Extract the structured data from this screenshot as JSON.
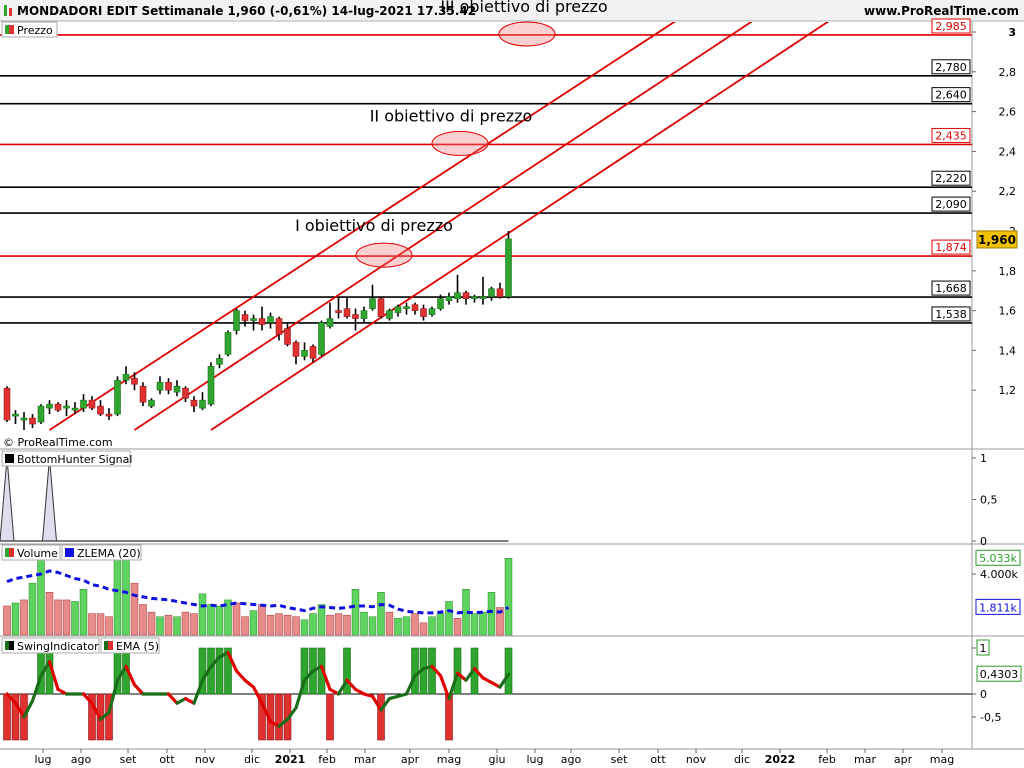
{
  "header": {
    "title": "MONDADORI EDIT Settimanale 1,960 (-0,61%) 14-lug-2021 17.35.42",
    "website": "www.ProRealTime.com",
    "copyright": "© ProRealTime.com"
  },
  "colors": {
    "up": "#2fa52f",
    "down": "#e03030",
    "channel": "#e00000",
    "level": "#000000",
    "zlema": "#1010e0",
    "ema": "#e00000",
    "swing": "#1a6e1a"
  },
  "chart_data": [
    {
      "type": "candlestick",
      "panel": "Prezzo",
      "legend": [
        "Prezzo"
      ],
      "ylim": [
        1.0,
        3.05
      ],
      "yticks": [
        "3",
        "2,8",
        "2,6",
        "2,4",
        "2,2",
        "2",
        "1,8",
        "1,6",
        "1,4",
        "1,2"
      ],
      "last_price_label": "1,960",
      "candles": [
        {
          "o": 1.21,
          "h": 1.22,
          "l": 1.04,
          "c": 1.05
        },
        {
          "o": 1.07,
          "h": 1.1,
          "l": 1.03,
          "c": 1.08
        },
        {
          "o": 1.05,
          "h": 1.09,
          "l": 1.0,
          "c": 1.06
        },
        {
          "o": 1.06,
          "h": 1.08,
          "l": 1.01,
          "c": 1.03
        },
        {
          "o": 1.04,
          "h": 1.13,
          "l": 1.03,
          "c": 1.12
        },
        {
          "o": 1.11,
          "h": 1.15,
          "l": 1.08,
          "c": 1.13
        },
        {
          "o": 1.13,
          "h": 1.14,
          "l": 1.09,
          "c": 1.1
        },
        {
          "o": 1.11,
          "h": 1.15,
          "l": 1.07,
          "c": 1.12
        },
        {
          "o": 1.1,
          "h": 1.14,
          "l": 1.08,
          "c": 1.11
        },
        {
          "o": 1.11,
          "h": 1.18,
          "l": 1.09,
          "c": 1.15
        },
        {
          "o": 1.15,
          "h": 1.17,
          "l": 1.1,
          "c": 1.11
        },
        {
          "o": 1.12,
          "h": 1.15,
          "l": 1.07,
          "c": 1.08
        },
        {
          "o": 1.08,
          "h": 1.11,
          "l": 1.05,
          "c": 1.07
        },
        {
          "o": 1.08,
          "h": 1.27,
          "l": 1.07,
          "c": 1.25
        },
        {
          "o": 1.25,
          "h": 1.32,
          "l": 1.23,
          "c": 1.28
        },
        {
          "o": 1.26,
          "h": 1.29,
          "l": 1.2,
          "c": 1.23
        },
        {
          "o": 1.22,
          "h": 1.24,
          "l": 1.12,
          "c": 1.14
        },
        {
          "o": 1.12,
          "h": 1.16,
          "l": 1.11,
          "c": 1.15
        },
        {
          "o": 1.2,
          "h": 1.27,
          "l": 1.18,
          "c": 1.24
        },
        {
          "o": 1.24,
          "h": 1.26,
          "l": 1.18,
          "c": 1.2
        },
        {
          "o": 1.19,
          "h": 1.25,
          "l": 1.17,
          "c": 1.22
        },
        {
          "o": 1.21,
          "h": 1.22,
          "l": 1.14,
          "c": 1.16
        },
        {
          "o": 1.15,
          "h": 1.17,
          "l": 1.09,
          "c": 1.12
        },
        {
          "o": 1.11,
          "h": 1.19,
          "l": 1.1,
          "c": 1.15
        },
        {
          "o": 1.13,
          "h": 1.34,
          "l": 1.12,
          "c": 1.32
        },
        {
          "o": 1.33,
          "h": 1.38,
          "l": 1.31,
          "c": 1.36
        },
        {
          "o": 1.38,
          "h": 1.5,
          "l": 1.37,
          "c": 1.49
        },
        {
          "o": 1.5,
          "h": 1.61,
          "l": 1.48,
          "c": 1.6
        },
        {
          "o": 1.58,
          "h": 1.6,
          "l": 1.52,
          "c": 1.55
        },
        {
          "o": 1.55,
          "h": 1.58,
          "l": 1.5,
          "c": 1.56
        },
        {
          "o": 1.56,
          "h": 1.62,
          "l": 1.5,
          "c": 1.53
        },
        {
          "o": 1.54,
          "h": 1.59,
          "l": 1.51,
          "c": 1.57
        },
        {
          "o": 1.56,
          "h": 1.57,
          "l": 1.45,
          "c": 1.48
        },
        {
          "o": 1.51,
          "h": 1.54,
          "l": 1.42,
          "c": 1.43
        },
        {
          "o": 1.44,
          "h": 1.45,
          "l": 1.33,
          "c": 1.37
        },
        {
          "o": 1.37,
          "h": 1.44,
          "l": 1.35,
          "c": 1.4
        },
        {
          "o": 1.42,
          "h": 1.43,
          "l": 1.34,
          "c": 1.36
        },
        {
          "o": 1.38,
          "h": 1.55,
          "l": 1.37,
          "c": 1.54
        },
        {
          "o": 1.52,
          "h": 1.64,
          "l": 1.51,
          "c": 1.56
        },
        {
          "o": 1.6,
          "h": 1.67,
          "l": 1.56,
          "c": 1.59
        },
        {
          "o": 1.61,
          "h": 1.67,
          "l": 1.56,
          "c": 1.57
        },
        {
          "o": 1.58,
          "h": 1.61,
          "l": 1.5,
          "c": 1.56
        },
        {
          "o": 1.56,
          "h": 1.62,
          "l": 1.54,
          "c": 1.6
        },
        {
          "o": 1.61,
          "h": 1.73,
          "l": 1.6,
          "c": 1.66
        },
        {
          "o": 1.66,
          "h": 1.67,
          "l": 1.56,
          "c": 1.57
        },
        {
          "o": 1.56,
          "h": 1.61,
          "l": 1.55,
          "c": 1.6
        },
        {
          "o": 1.59,
          "h": 1.63,
          "l": 1.57,
          "c": 1.62
        },
        {
          "o": 1.61,
          "h": 1.64,
          "l": 1.58,
          "c": 1.62
        },
        {
          "o": 1.63,
          "h": 1.64,
          "l": 1.58,
          "c": 1.6
        },
        {
          "o": 1.61,
          "h": 1.63,
          "l": 1.55,
          "c": 1.57
        },
        {
          "o": 1.58,
          "h": 1.62,
          "l": 1.57,
          "c": 1.61
        },
        {
          "o": 1.61,
          "h": 1.68,
          "l": 1.6,
          "c": 1.66
        },
        {
          "o": 1.65,
          "h": 1.69,
          "l": 1.63,
          "c": 1.67
        },
        {
          "o": 1.66,
          "h": 1.78,
          "l": 1.64,
          "c": 1.69
        },
        {
          "o": 1.69,
          "h": 1.7,
          "l": 1.63,
          "c": 1.66
        },
        {
          "o": 1.66,
          "h": 1.68,
          "l": 1.64,
          "c": 1.67
        },
        {
          "o": 1.66,
          "h": 1.77,
          "l": 1.63,
          "c": 1.67
        },
        {
          "o": 1.67,
          "h": 1.72,
          "l": 1.65,
          "c": 1.71
        },
        {
          "o": 1.71,
          "h": 1.74,
          "l": 1.66,
          "c": 1.67
        },
        {
          "o": 1.67,
          "h": 2.0,
          "l": 1.66,
          "c": 1.96
        }
      ],
      "levels": [
        {
          "value": 2.985,
          "label": "2,985",
          "color": "red"
        },
        {
          "value": 2.78,
          "label": "2,780",
          "color": "black"
        },
        {
          "value": 2.64,
          "label": "2,640",
          "color": "black"
        },
        {
          "value": 2.435,
          "label": "2,435",
          "color": "red"
        },
        {
          "value": 2.22,
          "label": "2,220",
          "color": "black"
        },
        {
          "value": 2.09,
          "label": "2,090",
          "color": "black"
        },
        {
          "value": 1.874,
          "label": "1,874",
          "color": "red"
        },
        {
          "value": 1.668,
          "label": "1,668",
          "color": "black"
        },
        {
          "value": 1.538,
          "label": "1,538",
          "color": "black"
        }
      ],
      "annotations": [
        {
          "text": "III obiettivo di prezzo",
          "target": 2.985
        },
        {
          "text": "II obiettivo di prezzo",
          "target": 2.435
        },
        {
          "text": "I obiettivo di prezzo",
          "target": 1.874
        }
      ],
      "channel_lines": [
        {
          "from": [
            5,
            1.0
          ],
          "to": [
            81,
            3.12
          ]
        },
        {
          "from": [
            15,
            1.0
          ],
          "to": [
            90,
            3.12
          ]
        },
        {
          "from": [
            24,
            1.0
          ],
          "to": [
            99,
            3.12
          ]
        }
      ]
    },
    {
      "type": "area",
      "panel": "BottomHunter Signal",
      "legend": [
        "BottomHunter Signal"
      ],
      "ylim": [
        0,
        1
      ],
      "yticks": [
        "1",
        "0,5",
        "0"
      ],
      "signal_weeks": [
        0,
        5
      ]
    },
    {
      "type": "bar",
      "panel": "Volume",
      "legend": [
        "Volume",
        "ZLEMA (20)"
      ],
      "yticks": [
        "4.000k"
      ],
      "value_labels": [
        "5.033k",
        "1.811k"
      ],
      "volume_k": [
        1900,
        2100,
        2300,
        3400,
        5100,
        2800,
        2300,
        2300,
        2200,
        3000,
        1400,
        1400,
        1200,
        5300,
        5100,
        3400,
        2000,
        1500,
        1200,
        1300,
        1200,
        1500,
        1400,
        2700,
        2000,
        1900,
        2300,
        2100,
        1200,
        1600,
        2000,
        1300,
        1400,
        1300,
        1200,
        1000,
        1400,
        2000,
        1300,
        1400,
        1300,
        3000,
        1500,
        1200,
        2800,
        1500,
        1100,
        1200,
        1400,
        800,
        1200,
        1400,
        2200,
        1100,
        3000,
        1400,
        1500,
        2800,
        1800,
        5033
      ],
      "zlema_k": [
        3500,
        3700,
        3800,
        3900,
        4000,
        4200,
        4100,
        3900,
        3700,
        3600,
        3300,
        3200,
        3000,
        2900,
        2800,
        2600,
        2500,
        2400,
        2350,
        2300,
        2200,
        2100,
        2000,
        1900,
        1950,
        1900,
        2000,
        2100,
        2050,
        2000,
        1950,
        1900,
        1950,
        1800,
        1700,
        1600,
        1750,
        1850,
        1800,
        1750,
        1800,
        1900,
        1900,
        1850,
        2000,
        1950,
        1700,
        1550,
        1500,
        1450,
        1450,
        1500,
        1600,
        1450,
        1500,
        1450,
        1500,
        1550,
        1500,
        1811
      ],
      "color_up": [
        false,
        true,
        false,
        true,
        true,
        false,
        false,
        false,
        true,
        true,
        false,
        false,
        false,
        true,
        true,
        false,
        false,
        false,
        true,
        false,
        true,
        false,
        false,
        true,
        true,
        true,
        true,
        false,
        false,
        true,
        false,
        false,
        false,
        false,
        false,
        true,
        true,
        true,
        false,
        false,
        false,
        true,
        true,
        true,
        true,
        false,
        true,
        true,
        false,
        false,
        true,
        true,
        true,
        false,
        true,
        true,
        true,
        true,
        false,
        true
      ]
    },
    {
      "type": "bar",
      "panel": "SwingIndicator",
      "legend": [
        "SwingIndicator",
        "EMA (5)"
      ],
      "ylim": [
        -0.65,
        1.25
      ],
      "yticks": [
        "1",
        "0",
        "-0,5"
      ],
      "value_labels": [
        "1",
        "0,4303"
      ],
      "swing": [
        -1,
        -1,
        -1,
        0,
        1,
        1,
        0,
        0,
        0,
        0,
        -1,
        -1,
        -1,
        1,
        1,
        0,
        0,
        0,
        0,
        0,
        0,
        0,
        0,
        1,
        1,
        1,
        1,
        0,
        0,
        0,
        -1,
        -1,
        -1,
        -1,
        0,
        1,
        1,
        1,
        -1,
        0,
        1,
        0,
        0,
        0,
        -1,
        0,
        0,
        0,
        1,
        1,
        1,
        0,
        -1,
        1,
        0,
        1,
        0,
        0,
        0,
        1
      ],
      "ema": [
        0.0,
        -0.2,
        -0.5,
        -0.15,
        0.4,
        0.7,
        0.1,
        0.0,
        0.0,
        0.0,
        -0.2,
        -0.55,
        -0.4,
        0.3,
        0.6,
        0.2,
        0.0,
        0.0,
        0.0,
        0.0,
        -0.2,
        -0.1,
        -0.2,
        0.3,
        0.6,
        0.8,
        0.9,
        0.5,
        0.3,
        0.15,
        -0.2,
        -0.6,
        -0.7,
        -0.55,
        -0.3,
        0.3,
        0.5,
        0.6,
        0.1,
        0.0,
        0.3,
        0.1,
        0.0,
        -0.05,
        -0.35,
        -0.1,
        -0.05,
        0.0,
        0.4,
        0.55,
        0.6,
        0.4,
        -0.1,
        0.45,
        0.3,
        0.55,
        0.35,
        0.25,
        0.15,
        0.4303
      ]
    }
  ],
  "x_axis_labels": [
    "lug",
    "ago",
    "set",
    "ott",
    "nov",
    "dic",
    "2021",
    "feb",
    "mar",
    "apr",
    "mag",
    "giu",
    "lug",
    "ago",
    "set",
    "ott",
    "nov",
    "dic",
    "2022",
    "feb",
    "mar",
    "apr",
    "mag"
  ]
}
